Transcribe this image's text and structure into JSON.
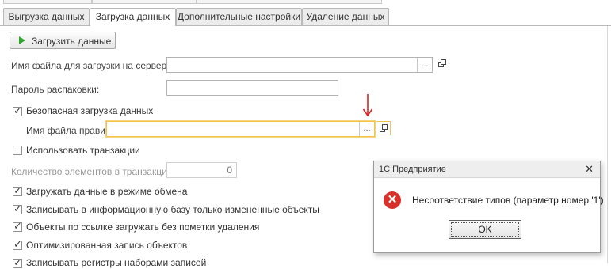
{
  "tabs": [
    {
      "label": "Выгрузка данных",
      "active": false
    },
    {
      "label": "Загрузка данных",
      "active": true
    },
    {
      "label": "Дополнительные настройки",
      "active": false
    },
    {
      "label": "Удаление данных",
      "active": false
    }
  ],
  "load_button": {
    "label": "Загрузить данные",
    "icon": "play-icon"
  },
  "server_file": {
    "label": "Имя файла для загрузки на сервере:",
    "value": "",
    "select_label": "...",
    "open_icon": "open-window-icon"
  },
  "unpack_password": {
    "label": "Пароль распаковки:",
    "value": ""
  },
  "safe_load": {
    "label": "Безопасная загрузка данных",
    "checked": true
  },
  "rules_file": {
    "label": "Имя файла правил:",
    "value": "",
    "select_label": "...",
    "open_icon": "open-window-icon"
  },
  "use_transactions": {
    "label": "Использовать транзакции",
    "checked": false
  },
  "transaction_count": {
    "label": "Количество элементов в транзакции:",
    "value": "0"
  },
  "options": [
    {
      "label": "Загружать данные в режиме обмена",
      "checked": true
    },
    {
      "label": "Записывать в информационную базу только измененные объекты",
      "checked": true
    },
    {
      "label": "Объекты по ссылке загружать без пометки удаления",
      "checked": true
    },
    {
      "label": "Оптимизированная запись объектов",
      "checked": true
    },
    {
      "label": "Записывать регистры наборами записей",
      "checked": true
    }
  ],
  "annotation": {
    "icon": "red-down-arrow-icon",
    "color": "#e02020"
  },
  "dialog": {
    "title": "1С:Предприятие",
    "close_label": "✕",
    "icon": "error-icon",
    "message": "Несоответствие типов (параметр номер '1')",
    "ok_label": "OK"
  },
  "colors": {
    "focus_border": "#f2c24d",
    "error_icon": "#d9302c",
    "annotation_arrow": "#e02020"
  }
}
